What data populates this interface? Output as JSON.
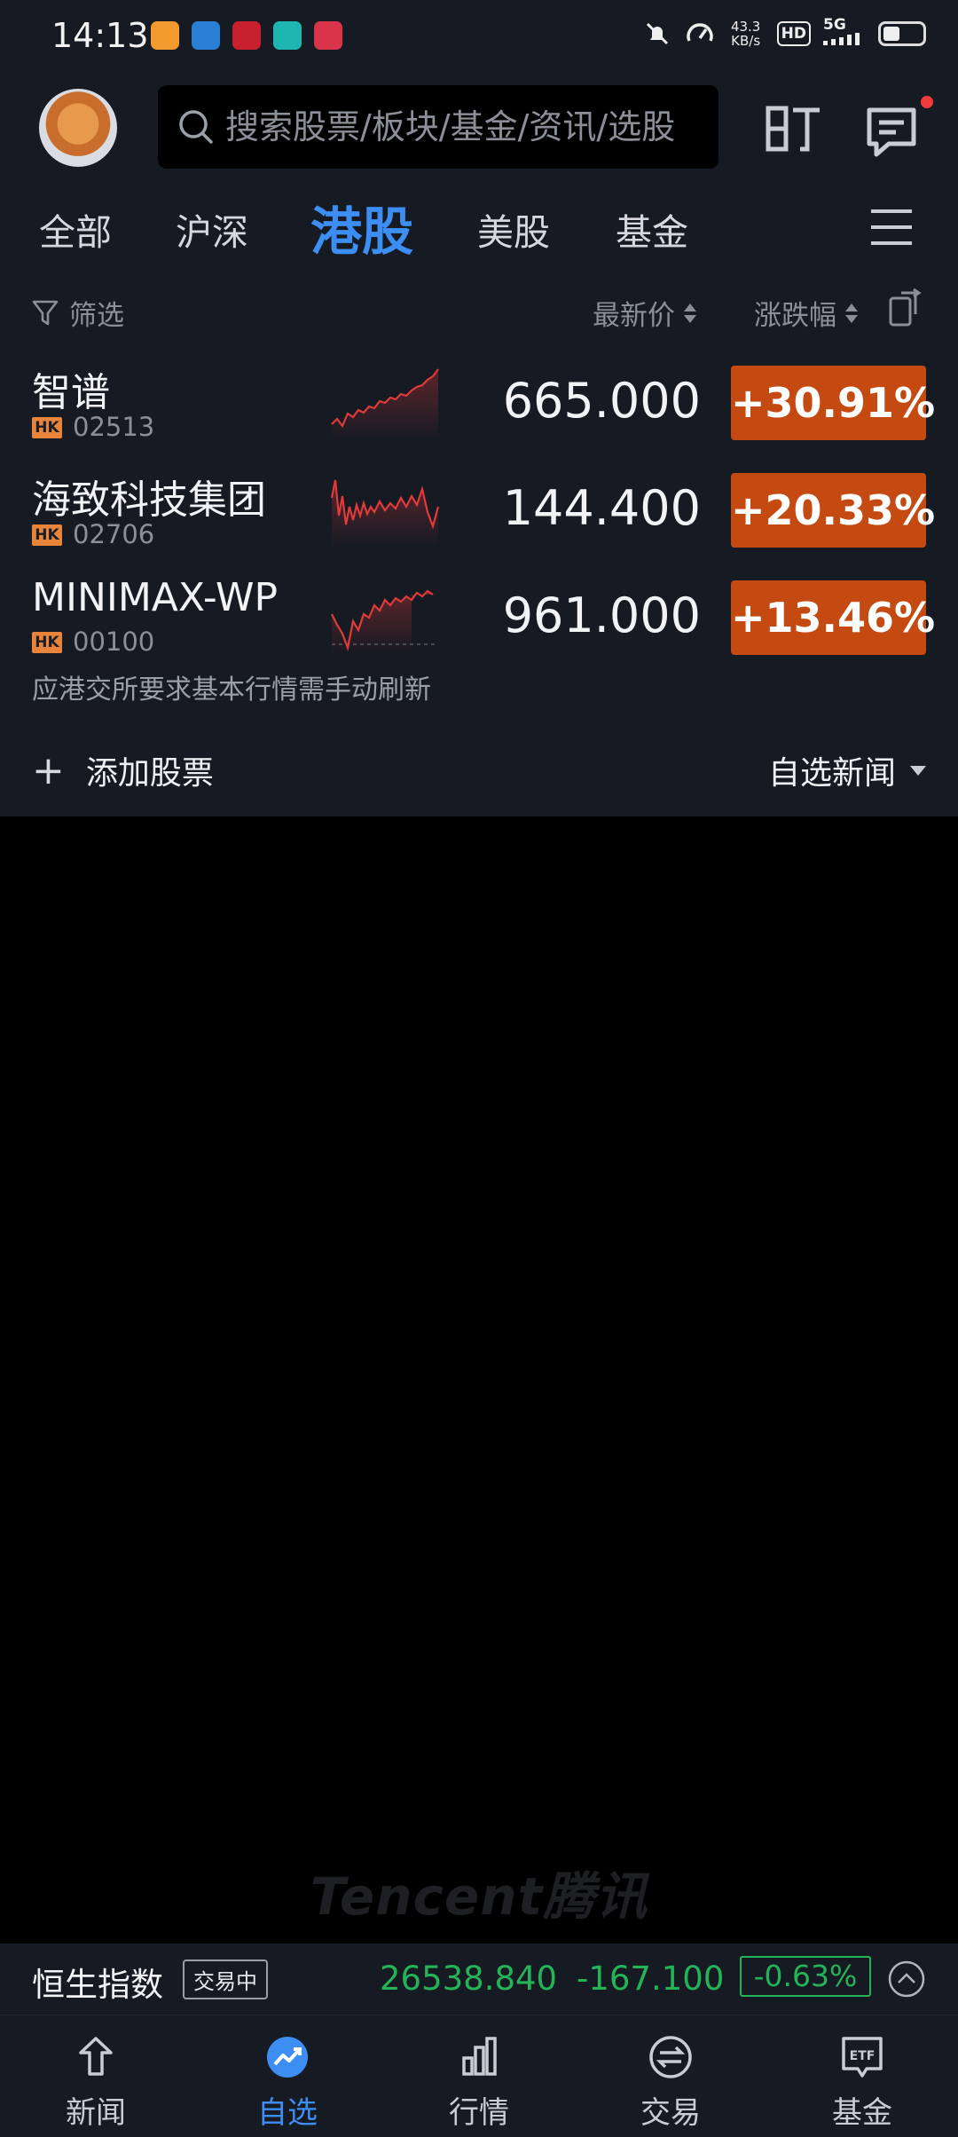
{
  "status_bar": {
    "time": "14:13",
    "network_speed_value": "43.3",
    "network_speed_unit": "KB/s",
    "hd_label": "HD",
    "signal_label": "5G",
    "notification_app_colors": [
      "#f29a2e",
      "#2a7fd4",
      "#c8202e",
      "#1fb5b0",
      "#d9344a"
    ]
  },
  "header": {
    "search_placeholder": "搜索股票/板块/基金/资讯/选股",
    "icons": [
      "avatar",
      "search-icon",
      "ding-icon",
      "message-icon"
    ],
    "has_message_dot": true
  },
  "tabs": [
    {
      "label": "全部",
      "active": false
    },
    {
      "label": "沪深",
      "active": false
    },
    {
      "label": "港股",
      "active": true
    },
    {
      "label": "美股",
      "active": false
    },
    {
      "label": "基金",
      "active": false
    }
  ],
  "filter_row": {
    "filter_label": "筛选",
    "price_sort_label": "最新价",
    "change_sort_label": "涨跌幅"
  },
  "stocks": [
    {
      "name": "智谱",
      "market": "HK",
      "code": "02513",
      "price": "665.000",
      "change": "+30.91%"
    },
    {
      "name": "海致科技集团",
      "market": "HK",
      "code": "02706",
      "price": "144.400",
      "change": "+20.33%"
    },
    {
      "name": "MINIMAX-WP",
      "market": "HK",
      "code": "00100",
      "price": "961.000",
      "change": "+13.46%"
    }
  ],
  "notice": "应港交所要求基本行情需手动刷新",
  "actions": {
    "add_stock": "添加股票",
    "news_toggle": "自选新闻"
  },
  "watermark": "Tencent腾讯",
  "index_bar": {
    "name": "恒生指数",
    "status": "交易中",
    "value": "26538.840",
    "change": "-167.100",
    "change_pct": "-0.63%"
  },
  "bottom_nav": [
    {
      "label": "新闻",
      "icon": "news-icon",
      "active": false
    },
    {
      "label": "自选",
      "icon": "watchlist-icon",
      "active": true
    },
    {
      "label": "行情",
      "icon": "market-icon",
      "active": false
    },
    {
      "label": "交易",
      "icon": "trade-icon",
      "active": false
    },
    {
      "label": "基金",
      "icon": "fund-icon",
      "active": false
    }
  ],
  "colors": {
    "background": "#161a23",
    "accent": "#3d8ef2",
    "up": "#c44a12",
    "down": "#25b357",
    "hk_badge": "#e8853a"
  }
}
